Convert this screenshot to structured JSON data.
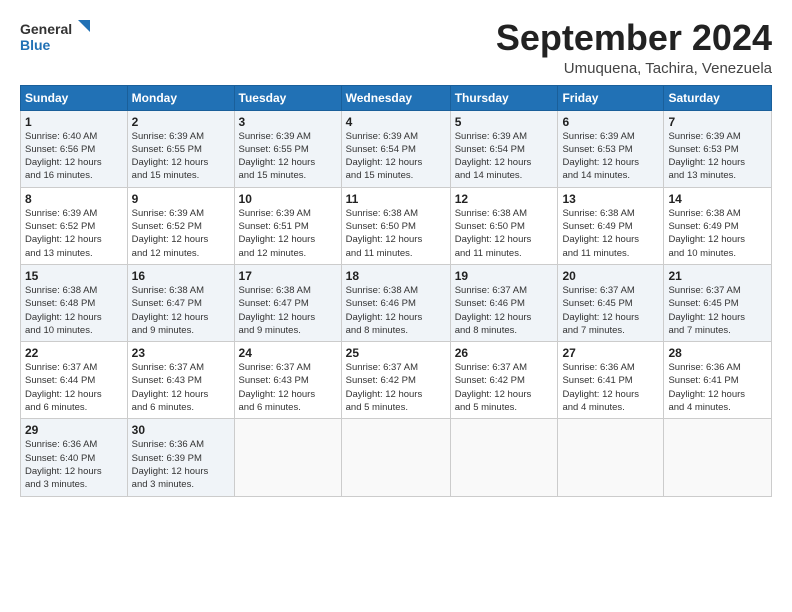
{
  "header": {
    "logo_line1": "General",
    "logo_line2": "Blue",
    "month": "September 2024",
    "location": "Umuquena, Tachira, Venezuela"
  },
  "weekdays": [
    "Sunday",
    "Monday",
    "Tuesday",
    "Wednesday",
    "Thursday",
    "Friday",
    "Saturday"
  ],
  "weeks": [
    [
      {
        "day": "1",
        "info": "Sunrise: 6:40 AM\nSunset: 6:56 PM\nDaylight: 12 hours\nand 16 minutes."
      },
      {
        "day": "2",
        "info": "Sunrise: 6:39 AM\nSunset: 6:55 PM\nDaylight: 12 hours\nand 15 minutes."
      },
      {
        "day": "3",
        "info": "Sunrise: 6:39 AM\nSunset: 6:55 PM\nDaylight: 12 hours\nand 15 minutes."
      },
      {
        "day": "4",
        "info": "Sunrise: 6:39 AM\nSunset: 6:54 PM\nDaylight: 12 hours\nand 15 minutes."
      },
      {
        "day": "5",
        "info": "Sunrise: 6:39 AM\nSunset: 6:54 PM\nDaylight: 12 hours\nand 14 minutes."
      },
      {
        "day": "6",
        "info": "Sunrise: 6:39 AM\nSunset: 6:53 PM\nDaylight: 12 hours\nand 14 minutes."
      },
      {
        "day": "7",
        "info": "Sunrise: 6:39 AM\nSunset: 6:53 PM\nDaylight: 12 hours\nand 13 minutes."
      }
    ],
    [
      {
        "day": "8",
        "info": "Sunrise: 6:39 AM\nSunset: 6:52 PM\nDaylight: 12 hours\nand 13 minutes."
      },
      {
        "day": "9",
        "info": "Sunrise: 6:39 AM\nSunset: 6:52 PM\nDaylight: 12 hours\nand 12 minutes."
      },
      {
        "day": "10",
        "info": "Sunrise: 6:39 AM\nSunset: 6:51 PM\nDaylight: 12 hours\nand 12 minutes."
      },
      {
        "day": "11",
        "info": "Sunrise: 6:38 AM\nSunset: 6:50 PM\nDaylight: 12 hours\nand 11 minutes."
      },
      {
        "day": "12",
        "info": "Sunrise: 6:38 AM\nSunset: 6:50 PM\nDaylight: 12 hours\nand 11 minutes."
      },
      {
        "day": "13",
        "info": "Sunrise: 6:38 AM\nSunset: 6:49 PM\nDaylight: 12 hours\nand 11 minutes."
      },
      {
        "day": "14",
        "info": "Sunrise: 6:38 AM\nSunset: 6:49 PM\nDaylight: 12 hours\nand 10 minutes."
      }
    ],
    [
      {
        "day": "15",
        "info": "Sunrise: 6:38 AM\nSunset: 6:48 PM\nDaylight: 12 hours\nand 10 minutes."
      },
      {
        "day": "16",
        "info": "Sunrise: 6:38 AM\nSunset: 6:47 PM\nDaylight: 12 hours\nand 9 minutes."
      },
      {
        "day": "17",
        "info": "Sunrise: 6:38 AM\nSunset: 6:47 PM\nDaylight: 12 hours\nand 9 minutes."
      },
      {
        "day": "18",
        "info": "Sunrise: 6:38 AM\nSunset: 6:46 PM\nDaylight: 12 hours\nand 8 minutes."
      },
      {
        "day": "19",
        "info": "Sunrise: 6:37 AM\nSunset: 6:46 PM\nDaylight: 12 hours\nand 8 minutes."
      },
      {
        "day": "20",
        "info": "Sunrise: 6:37 AM\nSunset: 6:45 PM\nDaylight: 12 hours\nand 7 minutes."
      },
      {
        "day": "21",
        "info": "Sunrise: 6:37 AM\nSunset: 6:45 PM\nDaylight: 12 hours\nand 7 minutes."
      }
    ],
    [
      {
        "day": "22",
        "info": "Sunrise: 6:37 AM\nSunset: 6:44 PM\nDaylight: 12 hours\nand 6 minutes."
      },
      {
        "day": "23",
        "info": "Sunrise: 6:37 AM\nSunset: 6:43 PM\nDaylight: 12 hours\nand 6 minutes."
      },
      {
        "day": "24",
        "info": "Sunrise: 6:37 AM\nSunset: 6:43 PM\nDaylight: 12 hours\nand 6 minutes."
      },
      {
        "day": "25",
        "info": "Sunrise: 6:37 AM\nSunset: 6:42 PM\nDaylight: 12 hours\nand 5 minutes."
      },
      {
        "day": "26",
        "info": "Sunrise: 6:37 AM\nSunset: 6:42 PM\nDaylight: 12 hours\nand 5 minutes."
      },
      {
        "day": "27",
        "info": "Sunrise: 6:36 AM\nSunset: 6:41 PM\nDaylight: 12 hours\nand 4 minutes."
      },
      {
        "day": "28",
        "info": "Sunrise: 6:36 AM\nSunset: 6:41 PM\nDaylight: 12 hours\nand 4 minutes."
      }
    ],
    [
      {
        "day": "29",
        "info": "Sunrise: 6:36 AM\nSunset: 6:40 PM\nDaylight: 12 hours\nand 3 minutes."
      },
      {
        "day": "30",
        "info": "Sunrise: 6:36 AM\nSunset: 6:39 PM\nDaylight: 12 hours\nand 3 minutes."
      },
      {
        "day": "",
        "info": ""
      },
      {
        "day": "",
        "info": ""
      },
      {
        "day": "",
        "info": ""
      },
      {
        "day": "",
        "info": ""
      },
      {
        "day": "",
        "info": ""
      }
    ]
  ]
}
